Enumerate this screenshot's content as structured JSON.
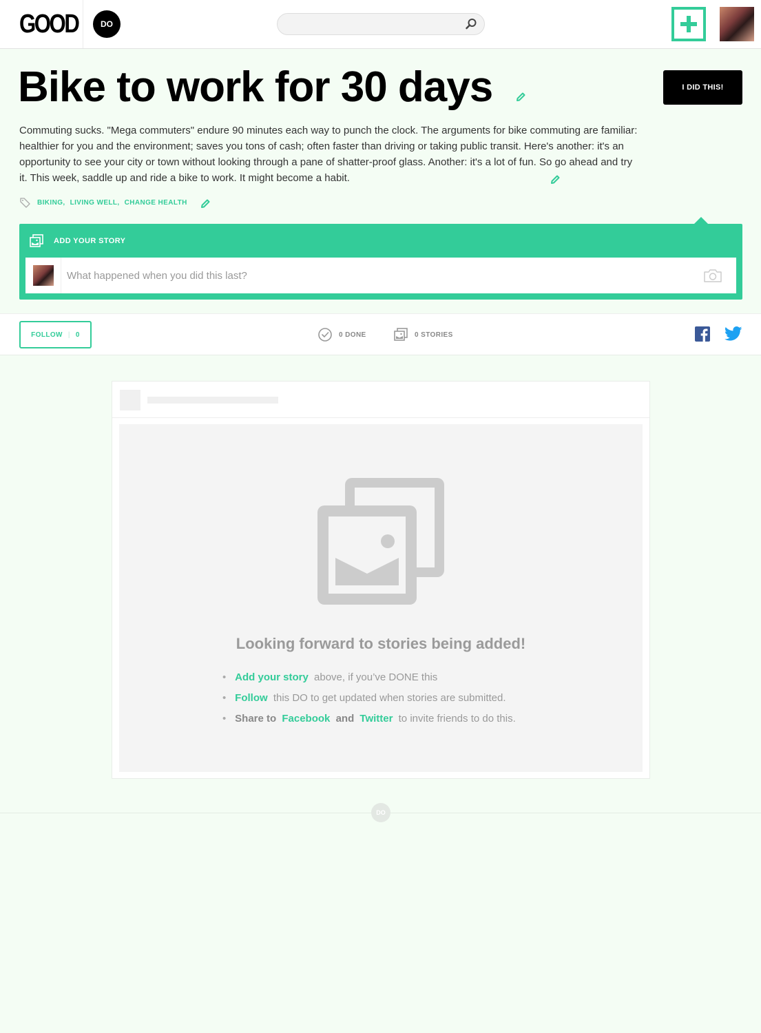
{
  "header": {
    "logo": "GOOD",
    "do_badge": "DO",
    "search": {
      "value": "",
      "placeholder": ""
    }
  },
  "challenge": {
    "title": "Bike to work for 30 days",
    "cta_label": "I DID THIS!",
    "description": "Commuting sucks. \"Mega commuters\" endure 90 minutes each way to punch the clock. The arguments for bike commuting are familiar: healthier for you and the environment; saves you tons of cash; often faster than driving or taking public transit. Here's another: it's an opportunity to see your city or town without looking through a pane of shatter-proof glass. Another: it's a lot of fun. So go ahead and try it. This week, saddle up and ride a bike to work. It might become a habit.",
    "tags": [
      "BIKING,",
      "LIVING WELL,",
      "CHANGE HEALTH"
    ]
  },
  "story": {
    "heading": "ADD YOUR STORY",
    "placeholder": "What happened when you did this last?"
  },
  "stats": {
    "follow_label": "FOLLOW",
    "follow_count": "0",
    "done_label": "0 DONE",
    "stories_label": "0 STORIES"
  },
  "empty_state": {
    "title": "Looking forward to stories being added!",
    "line1": {
      "link": "Add your story",
      "rest": "above, if you’ve DONE this"
    },
    "line2": {
      "link": "Follow",
      "rest": "this DO to get updated when stories are submitted."
    },
    "line3": {
      "pre": "Share to",
      "link1": "Facebook",
      "and": "and",
      "link2": "Twitter",
      "rest": "to invite friends to do this."
    }
  },
  "footer": {
    "badge": "DO"
  },
  "colors": {
    "accent": "#33cc99",
    "page_bg": "#f4fdf4",
    "black": "#000000"
  },
  "icons": [
    "search-icon",
    "plus-icon",
    "pencil-icon",
    "tag-icon",
    "photos-icon",
    "camera-icon",
    "check-circle-icon",
    "facebook-icon",
    "twitter-icon"
  ]
}
